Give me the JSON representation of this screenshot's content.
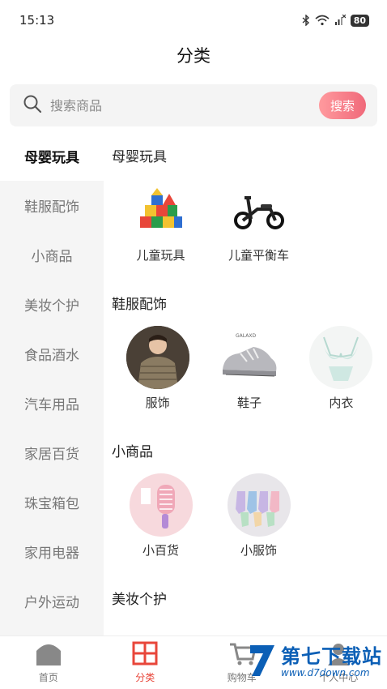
{
  "status_bar": {
    "time": "15:13",
    "battery": "80"
  },
  "header": {
    "title": "分类"
  },
  "search": {
    "placeholder": "搜索商品",
    "button_label": "搜索"
  },
  "sidebar": {
    "items": [
      {
        "label": "母婴玩具"
      },
      {
        "label": "鞋服配饰"
      },
      {
        "label": "小商品"
      },
      {
        "label": "美妆个护"
      },
      {
        "label": "食品酒水"
      },
      {
        "label": "汽车用品"
      },
      {
        "label": "家居百货"
      },
      {
        "label": "珠宝箱包"
      },
      {
        "label": "家用电器"
      },
      {
        "label": "户外运动"
      }
    ]
  },
  "sections": [
    {
      "title": "母婴玩具",
      "items": [
        {
          "label": "儿童玩具"
        },
        {
          "label": "儿童平衡车"
        }
      ]
    },
    {
      "title": "鞋服配饰",
      "items": [
        {
          "label": "服饰"
        },
        {
          "label": "鞋子",
          "brand": "GALAXD"
        },
        {
          "label": "内衣"
        }
      ]
    },
    {
      "title": "小商品",
      "items": [
        {
          "label": "小百货"
        },
        {
          "label": "小服饰"
        }
      ]
    },
    {
      "title": "美妆个护",
      "items": []
    }
  ],
  "tab_bar": {
    "tabs": [
      {
        "label": "首页",
        "icon": "home-icon"
      },
      {
        "label": "分类",
        "icon": "category-icon"
      },
      {
        "label": "购物车",
        "icon": "cart-icon"
      },
      {
        "label": "个人中心",
        "icon": "user-icon"
      }
    ]
  },
  "watermark": {
    "text": "第七下载站",
    "url": "www.d7down.com"
  },
  "colors": {
    "accent": "#e8463a",
    "search_button": "#f0697a",
    "watermark": "#0b5fb6"
  }
}
